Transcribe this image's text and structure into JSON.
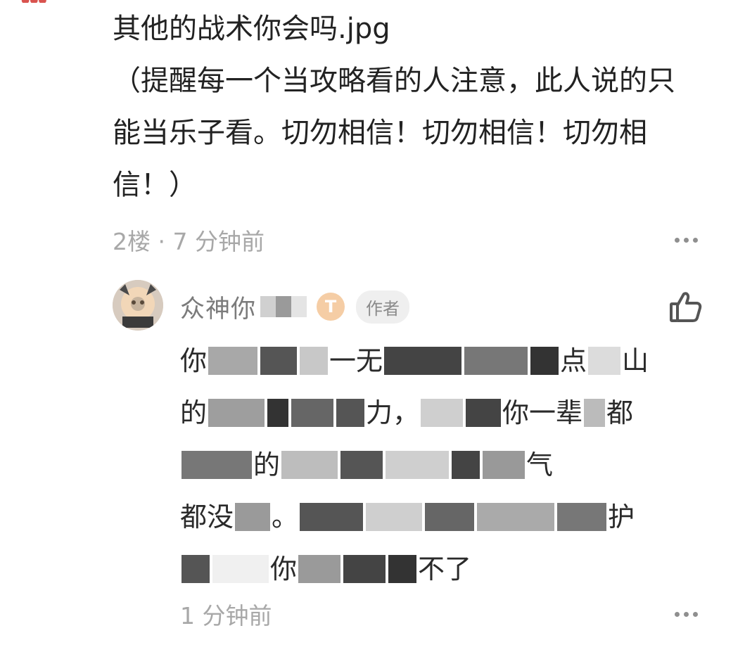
{
  "comment": {
    "lines": [
      "其他的战术你会吗.jpg",
      "（提醒每一个当攻略看的人注意，此人说的只",
      "能当乐子看。切勿相信！切勿相信！切勿相",
      "信！）"
    ],
    "meta": "2楼 · 7 分钟前"
  },
  "reply": {
    "username": "众神你",
    "level_badge": "T",
    "author_tag": "作者",
    "text_fragments": {
      "l1a": "你",
      "l1b": "一无",
      "l1c": "点",
      "l1d": "山",
      "l2a": "的",
      "l2b": "力，",
      "l2c": "你一辈",
      "l2d": "都",
      "l3a": "的",
      "l3b": "气",
      "l4a": "都没",
      "l4b": "。",
      "l4c": "护",
      "l5a": "你",
      "l5b": "不了"
    },
    "time": "1 分钟前"
  },
  "icons": {
    "more": "more-dots-icon",
    "like": "thumbs-up-icon"
  },
  "colors": {
    "text_primary": "#222222",
    "text_secondary": "#a8a8a8",
    "username": "#7b7b7b",
    "badge": "#f5cda5",
    "tag_bg": "#efefef"
  }
}
